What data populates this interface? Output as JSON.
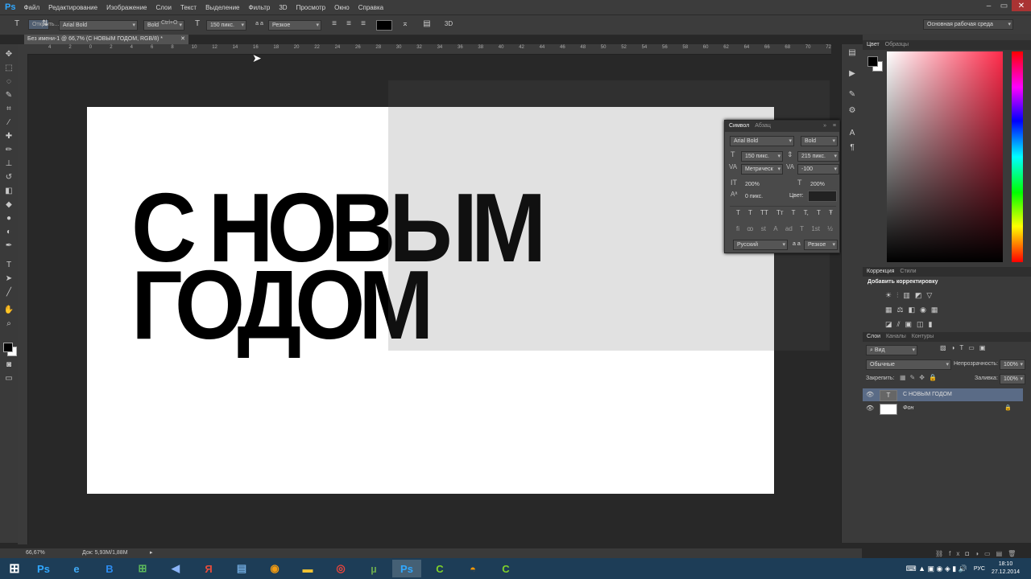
{
  "app": {
    "logo": "Ps",
    "menu": [
      "Файл",
      "Редактирование",
      "Изображение",
      "Слои",
      "Текст",
      "Выделение",
      "Фильтр",
      "3D",
      "Просмотр",
      "Окно",
      "Справка"
    ],
    "window_controls": [
      "–",
      "▭",
      "✕"
    ]
  },
  "options_bar": {
    "tool_glyph": "T",
    "font_family": "Arial Bold",
    "font_style": "Bold",
    "font_size": "150 пикс.",
    "aa_label": "a a",
    "antialias": "Резкое",
    "mode_3d": "3D",
    "workspace": "Основная рабочая среда",
    "text_color": "#000000"
  },
  "document": {
    "tab_title": "Без имени-1 @ 66,7% (С НОВЫМ ГОДОМ, RGB/8) *",
    "tab_close": "✕",
    "tooltip_left": "Открыть...",
    "tooltip_right": "Ctrl+O",
    "headline_line1": "С НОВЫМ",
    "headline_line2": "ГОДОМ",
    "ruler_ticks": [
      "4",
      "2",
      "0",
      "2",
      "4",
      "6",
      "8",
      "10",
      "12",
      "14",
      "16",
      "18",
      "20",
      "22",
      "24",
      "26",
      "28",
      "30",
      "32",
      "34",
      "36",
      "38",
      "40",
      "42",
      "44",
      "46",
      "48",
      "50",
      "52",
      "54",
      "56",
      "58",
      "60",
      "62",
      "64",
      "66",
      "68",
      "70",
      "72"
    ]
  },
  "character_panel": {
    "tab_symbol": "Символ",
    "tab_paragraph": "Абзац",
    "font_family": "Arial Bold",
    "font_style": "Bold",
    "size": "150 пикс.",
    "leading": "215 пикс.",
    "kerning": "Метрическ",
    "tracking": "-100",
    "vscale": "200%",
    "hscale": "200%",
    "baseline": "0 пикс.",
    "color_label": "Цвет:",
    "language": "Русский",
    "aa_label": "a a",
    "antialias": "Резкое",
    "style_glyphs": [
      "T",
      "T",
      "TT",
      "Tт",
      "T",
      "T,",
      "T",
      "Ŧ"
    ],
    "ot_glyphs": [
      "fi",
      "ꝏ",
      "st",
      "A",
      "ad",
      "T",
      "1st",
      "½"
    ]
  },
  "right_panels": {
    "color_tab": "Цвет",
    "swatches_tab": "Образцы",
    "correction_tab": "Коррекция",
    "styles_tab": "Стили",
    "add_adjustment": "Добавить корректировку",
    "layers_tab": "Слои",
    "channels_tab": "Каналы",
    "paths_tab": "Контуры",
    "filter_kind": "Вид",
    "blend_mode": "Обычные",
    "opacity_label": "Непрозрачность:",
    "opacity_value": "100%",
    "lock_label": "Закрепить:",
    "fill_label": "Заливка:",
    "fill_value": "100%",
    "foreground_color": "#000000",
    "background_color": "#ffffff",
    "layers": [
      {
        "name": "С НОВЫМ ГОДОМ",
        "type": "T"
      },
      {
        "name": "Фон",
        "type": ""
      }
    ]
  },
  "status_bar": {
    "zoom": "66,67%",
    "doc_info": "Док: 5,93М/1,88М"
  },
  "taskbar": {
    "tray_lang": "РУС",
    "time": "18:10",
    "date": "27.12.2014",
    "apps": [
      "Ps",
      "e",
      "B",
      "⊞",
      "◀",
      "Я",
      "▤",
      "◉",
      "▬",
      "◎",
      "µ",
      "Ps",
      "C",
      "◓",
      "C"
    ]
  }
}
